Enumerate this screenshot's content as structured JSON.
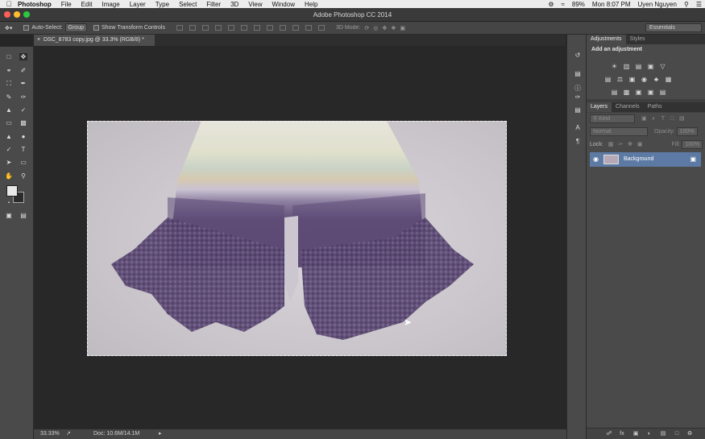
{
  "menubar": {
    "apple_icon": "apple-icon",
    "app_name": "Photoshop",
    "items": [
      "File",
      "Edit",
      "Image",
      "Layer",
      "Type",
      "Select",
      "Filter",
      "3D",
      "View",
      "Window",
      "Help"
    ],
    "battery": "89%",
    "clock": "Mon 8:07 PM",
    "user": "Uyen Nguyen"
  },
  "window": {
    "title": "Adobe Photoshop CC 2014"
  },
  "options_bar": {
    "auto_select_label": "Auto-Select:",
    "auto_select_value": "Group",
    "show_transform_label": "Show Transform Controls",
    "mode_3d_label": "3D Mode:",
    "workspace": "Essentials"
  },
  "document": {
    "tab_label": "DSC_8783 copy.jpg @ 33.3% (RGB/8) *"
  },
  "status_bar": {
    "zoom": "33.33%",
    "doc_size": "Doc: 10.6M/14.1M"
  },
  "adjustments_panel": {
    "tabs": [
      "Adjustments",
      "Styles"
    ],
    "title": "Add an adjustment"
  },
  "layers_panel": {
    "tabs": [
      "Layers",
      "Channels",
      "Paths"
    ],
    "filter_kind": "Kind",
    "blend_mode": "Normal",
    "opacity_label": "Opacity:",
    "opacity_value": "100%",
    "lock_label": "Lock:",
    "fill_label": "Fill:",
    "fill_value": "100%",
    "layers": [
      {
        "name": "Background",
        "visible": true,
        "locked": true
      }
    ]
  },
  "colors": {
    "canvas_bg": "#282828",
    "selected_layer": "#5c7aa3",
    "scarf_purple": "#5f4d78"
  }
}
